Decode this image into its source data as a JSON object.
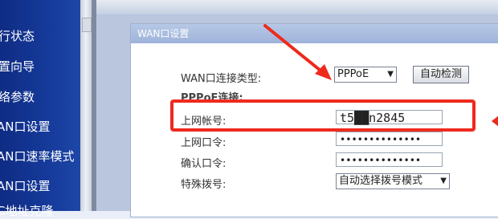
{
  "sidebar": {
    "items": [
      {
        "label": "行状态"
      },
      {
        "label": "置向导"
      },
      {
        "label": "络参数"
      },
      {
        "label": "AN口设置"
      },
      {
        "label": "AN口速率模式"
      },
      {
        "label": "AN口设置"
      },
      {
        "label": "C地址克隆"
      }
    ]
  },
  "panel": {
    "title": "WAN口设置",
    "connection_type_label": "WAN口连接类型:",
    "connection_type_value": "PPPoE",
    "detect_button": "自动检测",
    "pppoe_section": "PPPoE连接:",
    "account_label": "上网帐号:",
    "account_value": "t5██n2845",
    "password_label": "上网口令:",
    "password_value": "••••••••••••••",
    "confirm_label": "确认口令:",
    "confirm_value": "••••••••••••••",
    "dial_label": "特殊拨号:",
    "dial_value": "自动选择拨号模式"
  },
  "annotation": {
    "color": "#ee2a1d"
  }
}
